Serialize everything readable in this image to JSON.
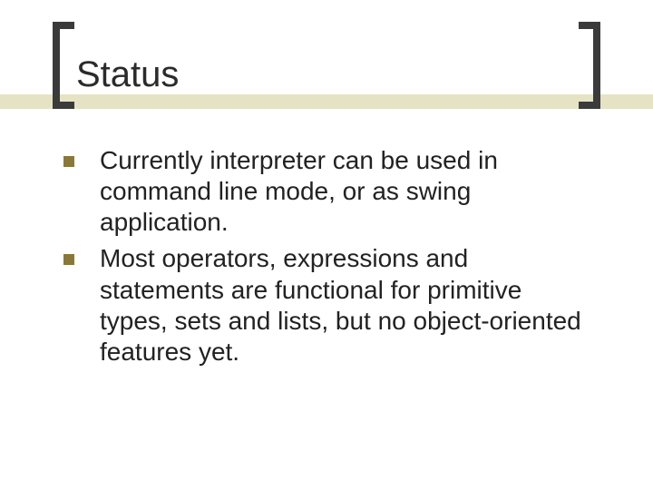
{
  "title": "Status",
  "bullets": [
    "Currently interpreter can be used in command line mode, or as swing application.",
    "Most operators, expressions and statements are functional for primitive types, sets and lists, but no object-oriented features yet."
  ],
  "colors": {
    "accent_bar": "#e6e3c4",
    "bullet_marker": "#8a783a",
    "bracket": "#3b3b3b"
  }
}
